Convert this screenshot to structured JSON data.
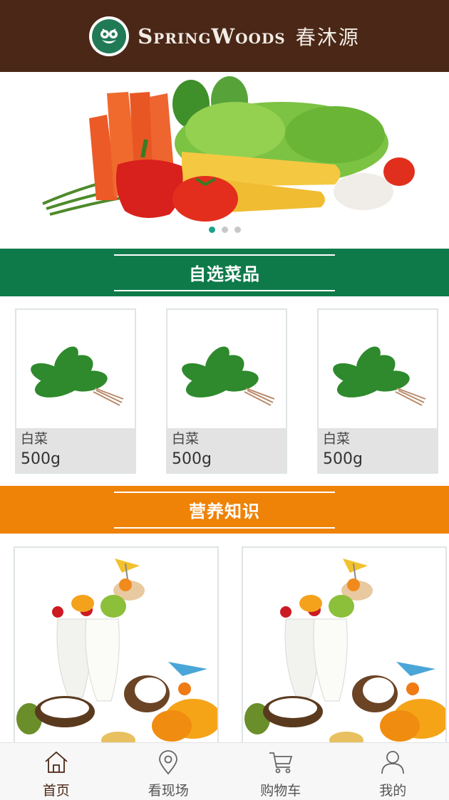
{
  "header": {
    "brand_en": "SpringWoods",
    "brand_cn": "春沐源",
    "logo_icon": "owl-logo-icon"
  },
  "banner": {
    "image": "vegetables-banner-image",
    "slide_count": 3,
    "active_slide": 1
  },
  "sections": {
    "vegetables": {
      "title": "自选菜品",
      "color": "#0e7a4a"
    },
    "nutrition": {
      "title": "营养知识",
      "color": "#ee8308"
    }
  },
  "products": [
    {
      "name": "白菜",
      "weight": "500g",
      "image": "spinach-image"
    },
    {
      "name": "白菜",
      "weight": "500g",
      "image": "spinach-image"
    },
    {
      "name": "白菜",
      "weight": "500g",
      "image": "spinach-image"
    }
  ],
  "articles": [
    {
      "image": "milkshake-fruit-image"
    },
    {
      "image": "milkshake-fruit-image"
    }
  ],
  "tabbar": {
    "items": [
      {
        "label": "首页",
        "icon": "home-icon",
        "active": true
      },
      {
        "label": "看现场",
        "icon": "location-pin-icon",
        "active": false
      },
      {
        "label": "购物车",
        "icon": "cart-icon",
        "active": false
      },
      {
        "label": "我的",
        "icon": "user-icon",
        "active": false
      }
    ],
    "active_color": "#4a2716",
    "inactive_color": "#555555"
  }
}
